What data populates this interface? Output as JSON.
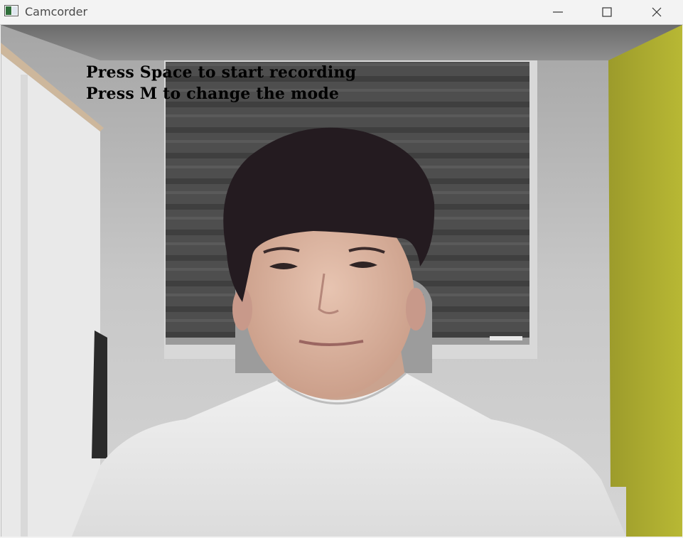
{
  "window": {
    "title": "Camcorder",
    "icon": "app-window-icon",
    "controls": [
      "minimize-icon",
      "maximize-icon",
      "close-icon"
    ]
  },
  "camera_feed": {
    "overlay_lines": [
      "Press Space to start recording",
      "Press M to change the mode"
    ]
  }
}
